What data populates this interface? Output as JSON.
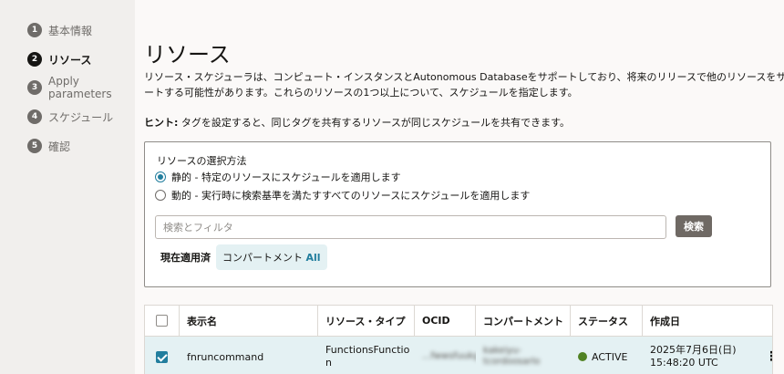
{
  "steps": [
    {
      "num": "1",
      "label": "基本情報",
      "active": false
    },
    {
      "num": "2",
      "label": "リソース",
      "active": true
    },
    {
      "num": "3",
      "label": "Apply parameters",
      "active": false
    },
    {
      "num": "4",
      "label": "スケジュール",
      "active": false
    },
    {
      "num": "5",
      "label": "確認",
      "active": false
    }
  ],
  "page": {
    "title": "リソース",
    "desc_line1": "リソース・スケジューラは、コンピュート・インスタンスとAutonomous Databaseをサポートしており、将来のリリースで他のリソースをサポ",
    "desc_line2": "ートする可能性があります。これらのリソースの1つ以上について、スケジュールを指定します。",
    "hint_bold": "ヒント:",
    "hint_text": " タグを設定すると、同じタグを共有するリソースが同じスケジュールを共有できます。"
  },
  "selection": {
    "label": "リソースの選択方法",
    "static_option": "静的 - 特定のリソースにスケジュールを適用します",
    "dynamic_option": "動的 - 実行時に検索基準を満たすすべてのリソースにスケジュールを適用します",
    "selected": "static",
    "search_placeholder": "検索とフィルタ",
    "search_button": "検索",
    "applied_label": "現在適用済",
    "chip_prefix": "コンパートメント ",
    "chip_value": "All"
  },
  "table": {
    "columns": [
      "表示名",
      "リソース・タイプ",
      "OCID",
      "コンパートメント",
      "ステータス",
      "作成日"
    ],
    "rows": [
      {
        "checked": true,
        "name": "fnruncommand",
        "type": "FunctionsFunction",
        "ocid": "...fwwsfuukgja",
        "compartment": "kakeiyu-tcordoosarlo",
        "status": "ACTIVE",
        "created": "2025年7月6日(日) 15:48:20 UTC",
        "actions": "⋮"
      }
    ]
  },
  "colors": {
    "accent": "#227e9e",
    "active_status": "#508223",
    "button": "#6f6964"
  }
}
